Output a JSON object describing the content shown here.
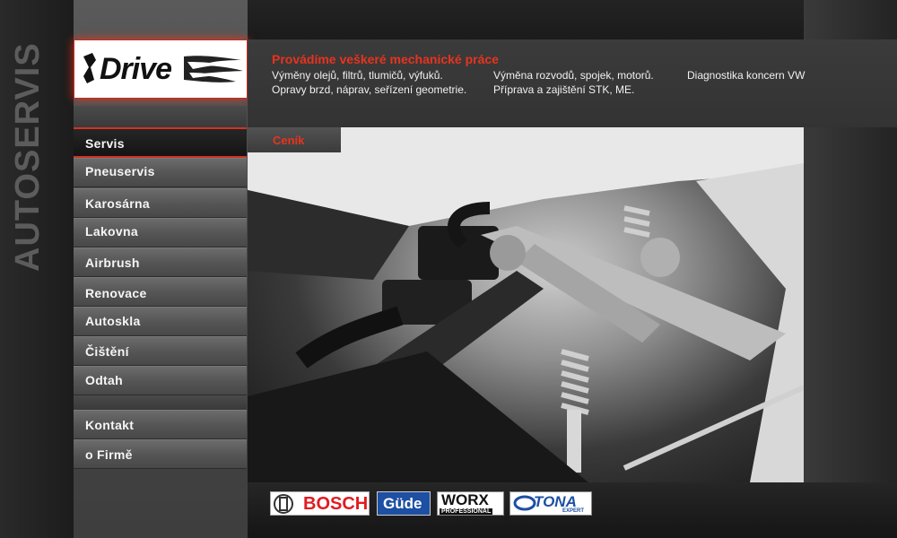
{
  "side_title": "AUTOSERVIS",
  "logo": {
    "text": "Drive"
  },
  "header": {
    "title": "Provádíme veškeré mechanické práce",
    "services": [
      "Výměny olejů, filtrů, tlumičů, výfuků.",
      "Opravy brzd, náprav, seřízení geometrie.",
      "Výměna rozvodů, spojek, motorů.",
      "Příprava a zajištění STK, ME.",
      "Diagnostika koncern VW"
    ]
  },
  "nav": {
    "items": [
      {
        "label": "Servis"
      },
      {
        "label": "Pneuservis"
      },
      {
        "label": "Karosárna"
      },
      {
        "label": "Lakovna"
      },
      {
        "label": "Airbrush"
      },
      {
        "label": "Renovace"
      },
      {
        "label": "Autoskla"
      },
      {
        "label": "Čištění"
      },
      {
        "label": "Odtah"
      },
      {
        "label": "Kontakt"
      },
      {
        "label": "o Firmě"
      }
    ],
    "active": "Servis"
  },
  "tab": {
    "label": "Ceník"
  },
  "brands": [
    {
      "name": "BOSCH"
    },
    {
      "name": "Güde"
    },
    {
      "name": "WORX",
      "sub": "PROFESSIONAL"
    },
    {
      "name": "TONA",
      "sub": "EXPERT"
    }
  ],
  "colors": {
    "accent": "#e8331e",
    "background": "#1e1e1e",
    "nav": "#555555"
  }
}
